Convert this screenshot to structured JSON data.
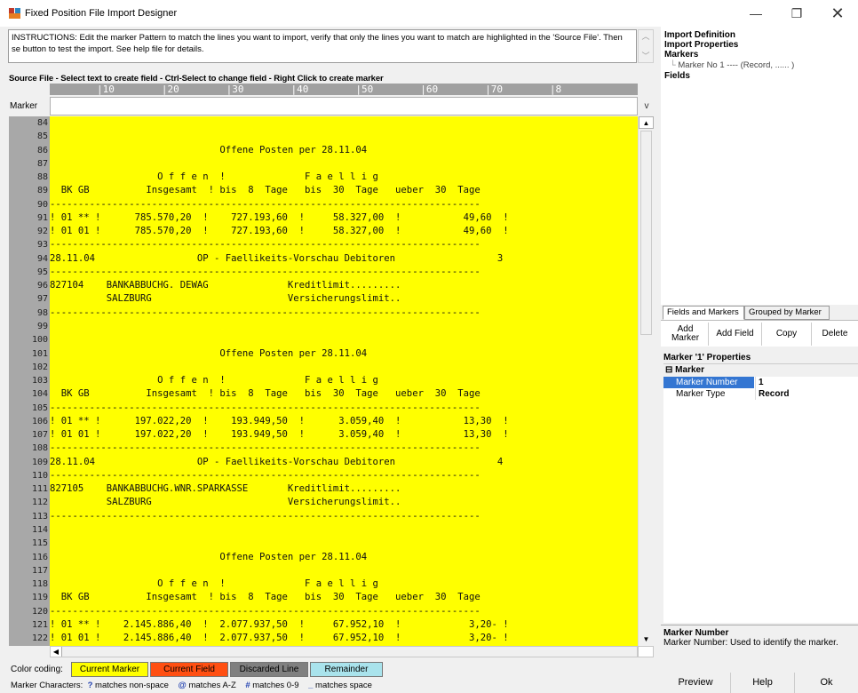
{
  "window": {
    "title": "Fixed Position File Import Designer",
    "min_glyph": "—",
    "max_glyph": "❐",
    "close_glyph": "✕"
  },
  "instructions": "INSTRUCTIONS: Edit the marker Pattern to match the lines you want to import, verify that only the lines you want to match are highlighted in the 'Source File'. Then se button to test the import. See help file for details.",
  "source_label": "Source File - Select text to create field - Ctrl-Select to change field - Right Click to create marker",
  "ruler": "        |10        |20        |30        |40        |50        |60        |70        |8",
  "marker_label": "Marker",
  "marker_value": "",
  "marker_dropdown": "v",
  "source_lines": [
    {
      "n": "84",
      "t": ""
    },
    {
      "n": "85",
      "t": ""
    },
    {
      "n": "86",
      "t": "                              Offene Posten per 28.11.04"
    },
    {
      "n": "87",
      "t": ""
    },
    {
      "n": "88",
      "t": "                   O f f e n  !              F a e l l i g"
    },
    {
      "n": "89",
      "t": "  BK GB          Insgesamt  ! bis  8  Tage   bis  30  Tage   ueber  30  Tage"
    },
    {
      "n": "90",
      "t": "----------------------------------------------------------------------------"
    },
    {
      "n": "91",
      "t": "! 01 ** !      785.570,20  !    727.193,60  !     58.327,00  !           49,60  !"
    },
    {
      "n": "92",
      "t": "! 01 01 !      785.570,20  !    727.193,60  !     58.327,00  !           49,60  !"
    },
    {
      "n": "93",
      "t": "----------------------------------------------------------------------------"
    },
    {
      "n": "94",
      "t": "28.11.04                  OP - Faellikeits-Vorschau Debitoren                  3"
    },
    {
      "n": "95",
      "t": "----------------------------------------------------------------------------"
    },
    {
      "n": "96",
      "t": "827104    BANKABBUCHG. DEWAG              Kreditlimit........."
    },
    {
      "n": "97",
      "t": "          SALZBURG                        Versicherungslimit.."
    },
    {
      "n": "98",
      "t": "----------------------------------------------------------------------------"
    },
    {
      "n": "99",
      "t": ""
    },
    {
      "n": "100",
      "t": ""
    },
    {
      "n": "101",
      "t": "                              Offene Posten per 28.11.04"
    },
    {
      "n": "102",
      "t": ""
    },
    {
      "n": "103",
      "t": "                   O f f e n  !              F a e l l i g"
    },
    {
      "n": "104",
      "t": "  BK GB          Insgesamt  ! bis  8  Tage   bis  30  Tage   ueber  30  Tage"
    },
    {
      "n": "105",
      "t": "----------------------------------------------------------------------------"
    },
    {
      "n": "106",
      "t": "! 01 ** !      197.022,20  !    193.949,50  !      3.059,40  !           13,30  !"
    },
    {
      "n": "107",
      "t": "! 01 01 !      197.022,20  !    193.949,50  !      3.059,40  !           13,30  !"
    },
    {
      "n": "108",
      "t": "----------------------------------------------------------------------------"
    },
    {
      "n": "109",
      "t": "28.11.04                  OP - Faellikeits-Vorschau Debitoren                  4"
    },
    {
      "n": "110",
      "t": "----------------------------------------------------------------------------"
    },
    {
      "n": "111",
      "t": "827105    BANKABBUCHG.WNR.SPARKASSE       Kreditlimit........."
    },
    {
      "n": "112",
      "t": "          SALZBURG                        Versicherungslimit.."
    },
    {
      "n": "113",
      "t": "----------------------------------------------------------------------------"
    },
    {
      "n": "114",
      "t": ""
    },
    {
      "n": "115",
      "t": ""
    },
    {
      "n": "116",
      "t": "                              Offene Posten per 28.11.04"
    },
    {
      "n": "117",
      "t": ""
    },
    {
      "n": "118",
      "t": "                   O f f e n  !              F a e l l i g"
    },
    {
      "n": "119",
      "t": "  BK GB          Insgesamt  ! bis  8  Tage   bis  30  Tage   ueber  30  Tage"
    },
    {
      "n": "120",
      "t": "----------------------------------------------------------------------------"
    },
    {
      "n": "121",
      "t": "! 01 ** !    2.145.886,40  !  2.077.937,50  !     67.952,10  !            3,20- !"
    },
    {
      "n": "122",
      "t": "! 01 01 !    2.145.886,40  !  2.077.937,50  !     67.952,10  !            3,20- !"
    },
    {
      "n": "123",
      "t": "----------------------------------------------------------------------------"
    }
  ],
  "legend": {
    "label": "Color coding:",
    "current_marker": "Current Marker",
    "current_field": "Current Field",
    "discarded_line": "Discarded Line",
    "remainder": "Remainder",
    "colors": {
      "current_marker": "#ffff00",
      "current_field": "#ff4f12",
      "discarded_line": "#808080",
      "remainder": "#a9e3ec"
    }
  },
  "marker_chars": {
    "label": "Marker Characters:",
    "q_sym": "?",
    "q_text": "matches non-space",
    "at_sym": "@",
    "at_text": "matches A-Z",
    "hash_sym": "#",
    "hash_text": "matches 0-9",
    "us_sym": "_",
    "us_text": "matches space"
  },
  "tree": {
    "import_definition": "Import Definition",
    "import_properties": "Import Properties",
    "markers": "Markers",
    "marker_item": "Marker No 1 ---- (Record, ...... )",
    "fields": "Fields"
  },
  "tabs": {
    "fields_and_markers": "Fields and Markers",
    "grouped_by_marker": "Grouped by Marker"
  },
  "toolbar": {
    "add_marker": "Add Marker",
    "add_field": "Add Field",
    "copy": "Copy",
    "delete": "Delete"
  },
  "properties": {
    "title": "Marker '1' Properties",
    "category": "Marker",
    "rows": [
      {
        "key": "Marker Number",
        "value": "1"
      },
      {
        "key": "Marker Type",
        "value": "Record"
      }
    ]
  },
  "help": {
    "heading": "Marker Number",
    "text": "Marker Number: Used to identify the marker."
  },
  "buttons": {
    "preview": "Preview",
    "help": "Help",
    "ok": "Ok"
  }
}
